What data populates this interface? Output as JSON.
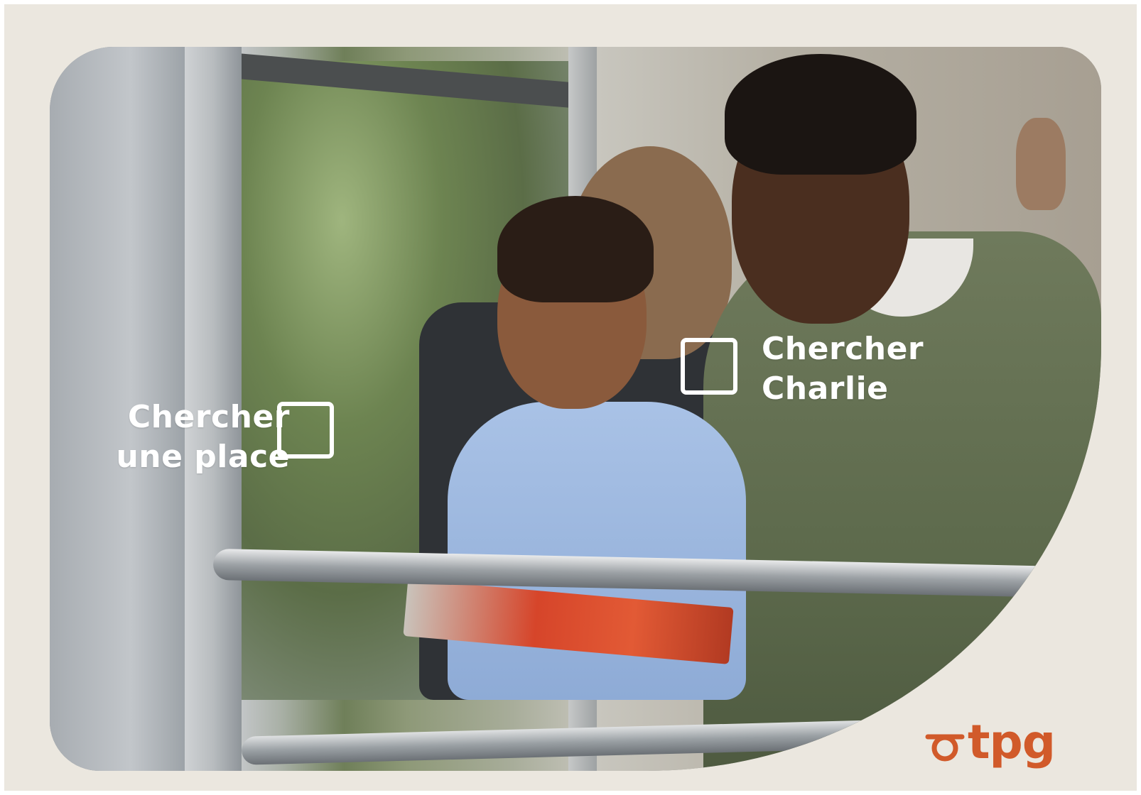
{
  "poster": {
    "background_color": "#ebe7df",
    "accent_color": "#d15a2a",
    "text_color": "#ffffff"
  },
  "option_left": {
    "line1": "Chercher",
    "line2": "une place",
    "checked": false
  },
  "option_right": {
    "line1": "Chercher",
    "line2": "Charlie",
    "checked": false
  },
  "logo": {
    "text": "tpg",
    "mark_icon": "sigma-swoosh-icon"
  }
}
